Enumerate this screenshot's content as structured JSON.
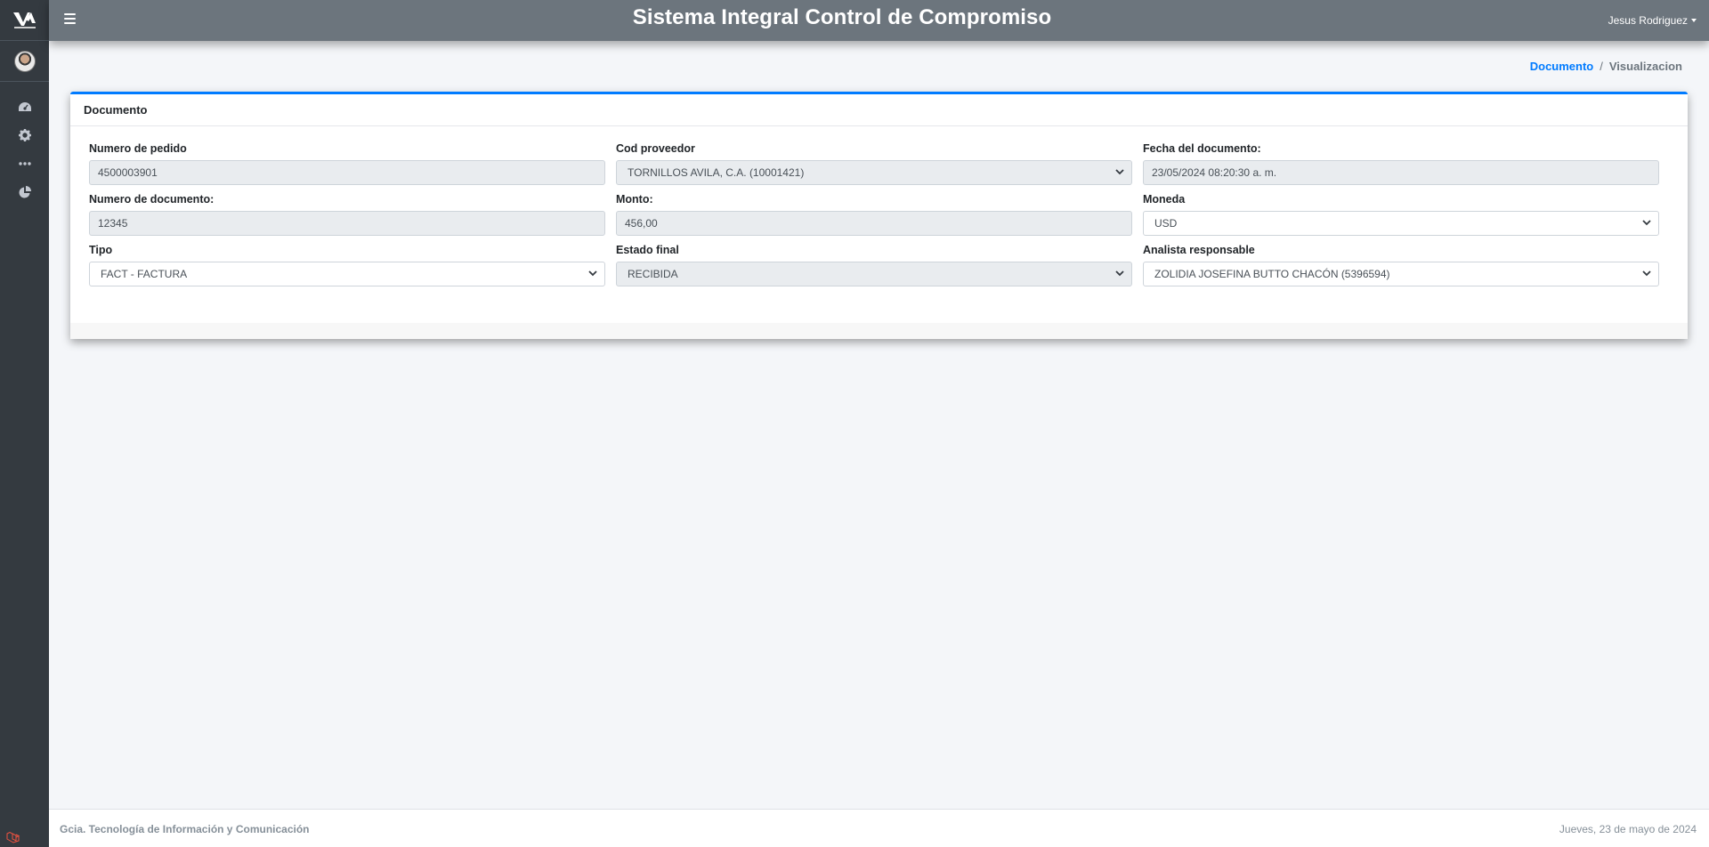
{
  "app": {
    "title": "Sistema Integral Control de Compromiso",
    "user": "Jesus Rodriguez"
  },
  "sidebar": {
    "items": [
      {
        "icon": "dashboard-icon"
      },
      {
        "icon": "gear-icon"
      },
      {
        "icon": "more-dots-icon"
      },
      {
        "icon": "pie-chart-icon"
      }
    ]
  },
  "breadcrumb": {
    "link": "Documento",
    "separator": "/",
    "current": "Visualizacion"
  },
  "card": {
    "title": "Documento",
    "fields": {
      "numero_pedido": {
        "label": "Numero de pedido",
        "value": "4500003901"
      },
      "cod_proveedor": {
        "label": "Cod proveedor",
        "value": "TORNILLOS AVILA, C.A. (10001421)"
      },
      "fecha_documento": {
        "label": "Fecha del documento:",
        "value": "23/05/2024 08:20:30 a. m."
      },
      "numero_documento": {
        "label": "Numero de documento:",
        "value": "12345"
      },
      "monto": {
        "label": "Monto:",
        "value": "456,00"
      },
      "moneda": {
        "label": "Moneda",
        "value": "USD"
      },
      "tipo": {
        "label": "Tipo",
        "value": "FACT - FACTURA"
      },
      "estado_final": {
        "label": "Estado final",
        "value": "RECIBIDA"
      },
      "analista": {
        "label": "Analista responsable",
        "value": "ZOLIDIA JOSEFINA BUTTO CHACÓN (5396594)"
      }
    }
  },
  "footer": {
    "left": "Gcia. Tecnología de Información y Comunicación",
    "right": "Jueves, 23 de mayo de 2024"
  },
  "colors": {
    "accent": "#007bff",
    "navbar": "#6c757d",
    "sidebar": "#343a40",
    "background": "#f4f6f9"
  }
}
